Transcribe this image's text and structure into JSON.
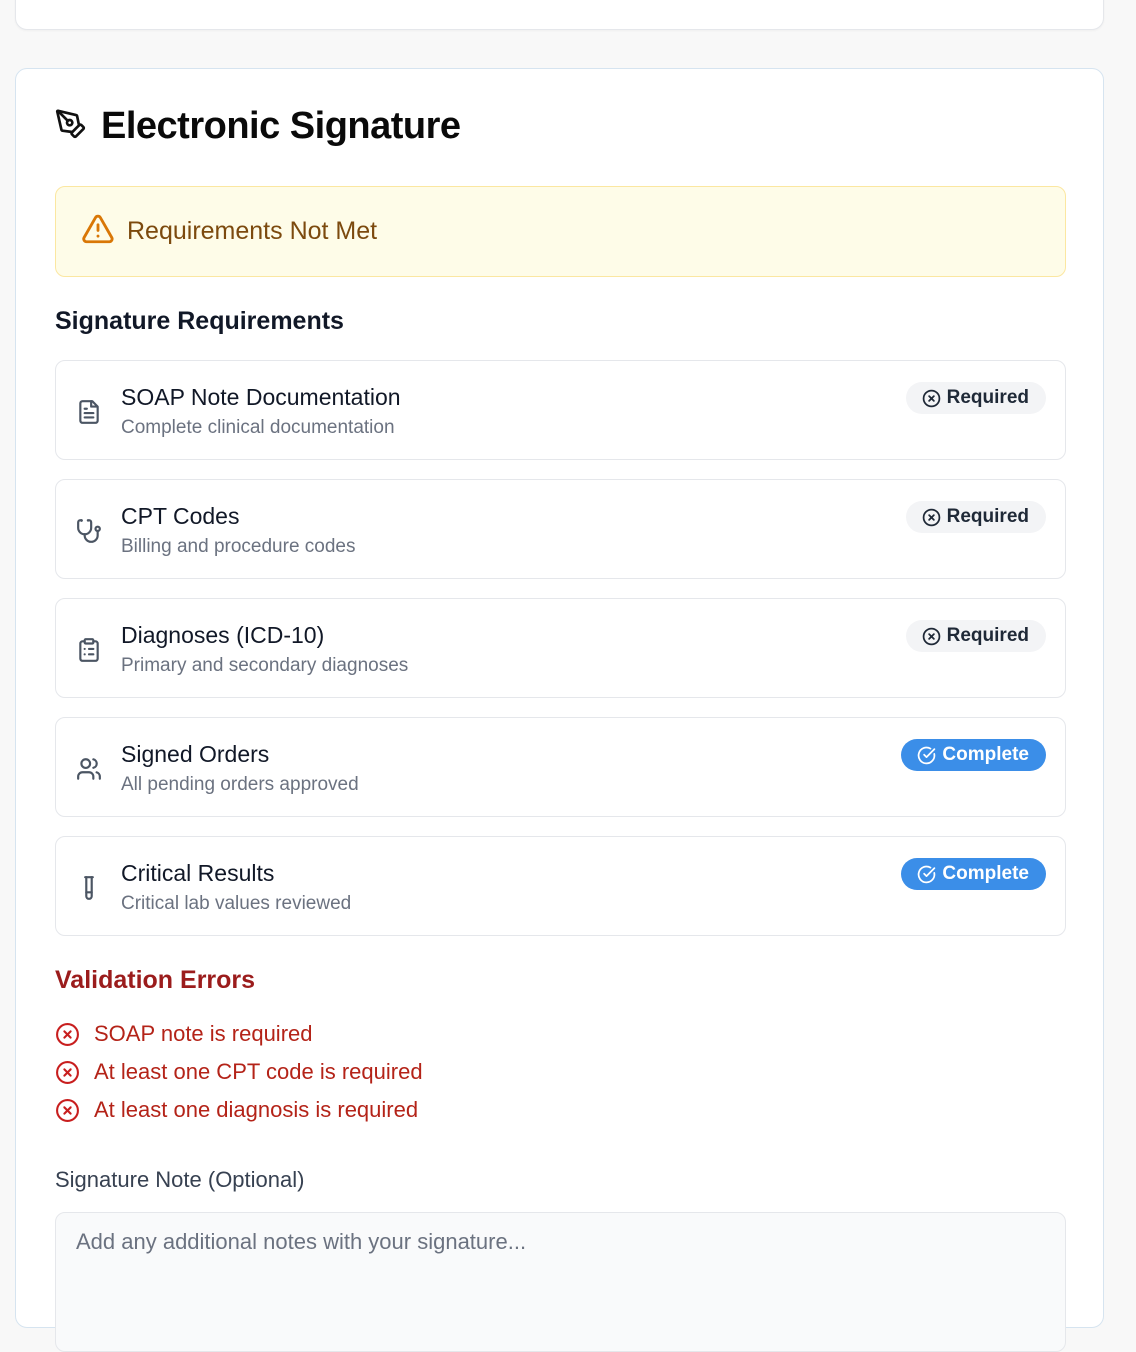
{
  "signature": {
    "title": "Electronic Signature",
    "alert": "Requirements Not Met",
    "requirements_title": "Signature Requirements",
    "requirements": [
      {
        "name": "SOAP Note Documentation",
        "desc": "Complete clinical documentation",
        "status": "Required",
        "icon": "document-icon"
      },
      {
        "name": "CPT Codes",
        "desc": "Billing and procedure codes",
        "status": "Required",
        "icon": "stethoscope-icon"
      },
      {
        "name": "Diagnoses (ICD-10)",
        "desc": "Primary and secondary diagnoses",
        "status": "Required",
        "icon": "clipboard-list-icon"
      },
      {
        "name": "Signed Orders",
        "desc": "All pending orders approved",
        "status": "Complete",
        "icon": "users-icon"
      },
      {
        "name": "Critical Results",
        "desc": "Critical lab values reviewed",
        "status": "Complete",
        "icon": "test-tube-icon"
      }
    ],
    "errors_title": "Validation Errors",
    "errors": [
      "SOAP note is required",
      "At least one CPT code is required",
      "At least one diagnosis is required"
    ],
    "note_label": "Signature Note (Optional)",
    "note_placeholder": "Add any additional notes with your signature...",
    "note_value": ""
  },
  "colors": {
    "alert_bg": "#fefce8",
    "alert_text": "#7c4a0e",
    "complete_badge": "#3b8ee8",
    "required_badge": "#f3f4f6",
    "error_text": "#b42318"
  }
}
